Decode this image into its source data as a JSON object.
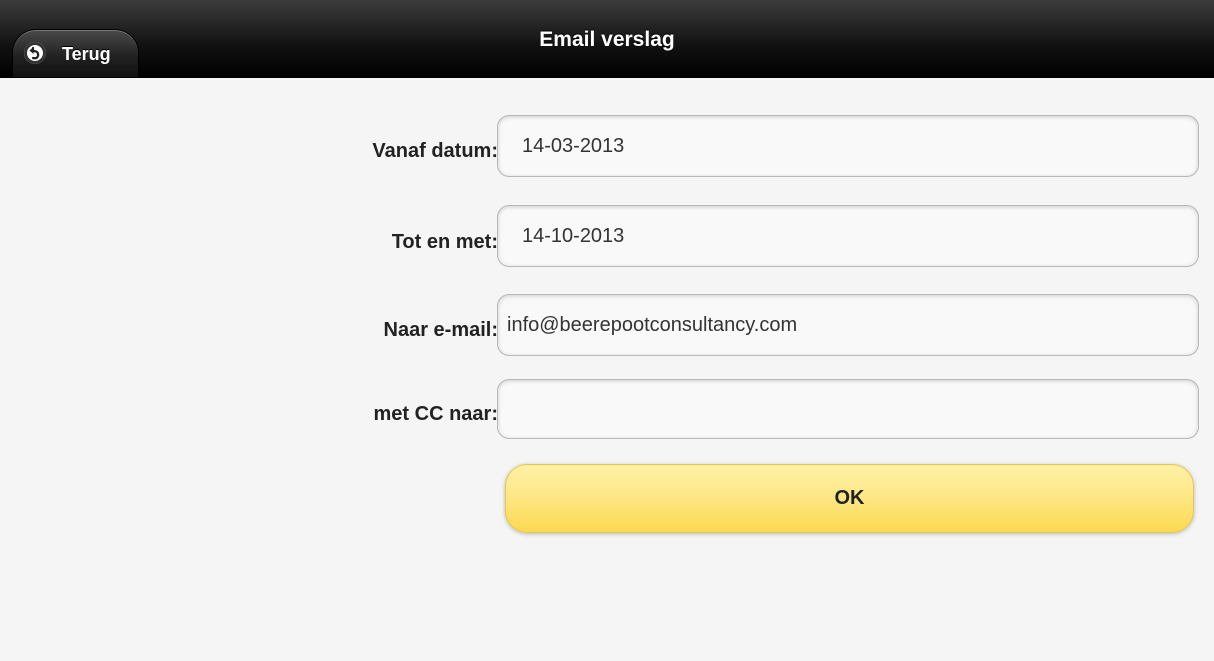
{
  "header": {
    "title": "Email verslag",
    "back_label": "Terug"
  },
  "form": {
    "from_date": {
      "label": "Vanaf datum:",
      "value": "14-03-2013"
    },
    "to_date": {
      "label": "Tot en met:",
      "value": "14-10-2013"
    },
    "email": {
      "label": "Naar e-mail:",
      "value": "info@beerepootconsultancy.com"
    },
    "cc": {
      "label": "met CC naar:",
      "value": ""
    },
    "submit_label": "OK"
  },
  "colors": {
    "header_bg": "#111111",
    "page_bg": "#f5f5f5",
    "button_yellow": "#fde888"
  },
  "icons": {
    "back": "back-arrow-icon"
  }
}
